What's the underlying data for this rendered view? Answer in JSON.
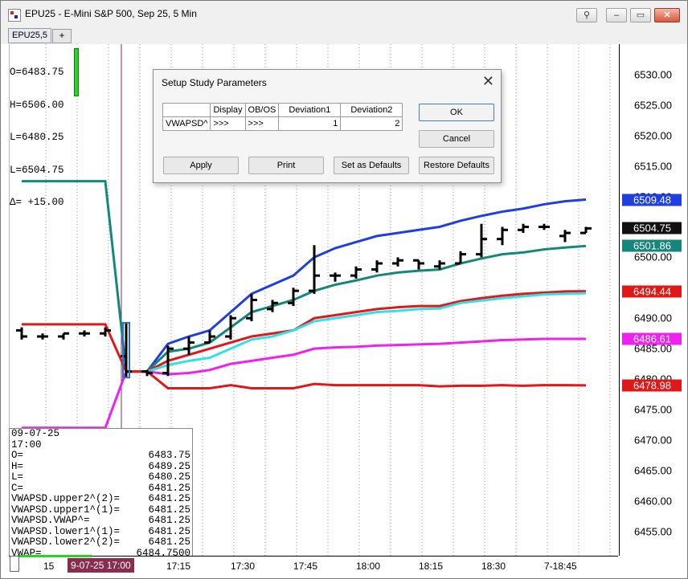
{
  "window": {
    "title": "EPU25 - E-Mini S&P 500, Sep 25, 5 Min",
    "close_glyph": "✕",
    "min_glyph": "–",
    "max_glyph": "▭",
    "link_glyph": "⚲"
  },
  "tabs": {
    "active_label": "EPU25,5",
    "add_label": "+"
  },
  "ohlc_overlay": [
    "O=6483.75",
    "H=6506.00",
    "L=6480.25",
    "L=6504.75",
    "Δ= +15.00"
  ],
  "data_window": {
    "date": "09-07-25",
    "time": "17:00",
    "rows": [
      {
        "k": "O=",
        "v": "6483.75"
      },
      {
        "k": "H=",
        "v": "6489.25"
      },
      {
        "k": "L=",
        "v": "6480.25"
      },
      {
        "k": "C=",
        "v": "6481.25"
      },
      {
        "k": "VWAPSD.upper2^(2)=",
        "v": "6481.25"
      },
      {
        "k": "VWAPSD.upper1^(1)=",
        "v": "6481.25"
      },
      {
        "k": "VWAPSD.VWAP^=",
        "v": "6481.25"
      },
      {
        "k": "VWAPSD.lower1^(1)=",
        "v": "6481.25"
      },
      {
        "k": "VWAPSD.lower2^(2)=",
        "v": "6481.25"
      },
      {
        "k": "VWAP=",
        "v": "6484.7500"
      }
    ]
  },
  "time_axis": {
    "cursor_label": "9-07-25  17:00",
    "labels": [
      {
        "text": "15",
        "x": 0
      },
      {
        "text": "17:15",
        "x": 0
      },
      {
        "text": "17:30",
        "x": 0
      },
      {
        "text": "17:45",
        "x": 0
      },
      {
        "text": "18:00",
        "x": 0
      },
      {
        "text": "18:15",
        "x": 0
      },
      {
        "text": "18:30",
        "x": 0
      },
      {
        "text": "7-18:45",
        "x": 0
      }
    ]
  },
  "price_axis": {
    "labels": [
      "6530.00",
      "6525.00",
      "6520.00",
      "6515.00",
      "6510.00",
      "6500.00",
      "6490.00",
      "6485.00",
      "6480.00",
      "6475.00",
      "6470.00",
      "6465.00",
      "6460.00",
      "6455.00"
    ],
    "badges": [
      {
        "text": "6509.48",
        "color": "#1f3fe0"
      },
      {
        "text": "6504.75",
        "color": "#111111"
      },
      {
        "text": "6501.86",
        "color": "#15877a"
      },
      {
        "text": "6494.44",
        "color": "#e01818"
      },
      {
        "text": "6486.61",
        "color": "#ee22ee"
      },
      {
        "text": "6478.98",
        "color": "#e01818"
      }
    ]
  },
  "chart_data": {
    "type": "line",
    "ylim": [
      6451,
      6535
    ],
    "x": [
      "16:35",
      "16:40",
      "16:45",
      "16:50",
      "16:55",
      "17:00",
      "17:05",
      "17:10",
      "17:15",
      "17:20",
      "17:25",
      "17:30",
      "17:35",
      "17:40",
      "17:45",
      "17:50",
      "17:55",
      "18:00",
      "18:05",
      "18:10",
      "18:15",
      "18:20",
      "18:25",
      "18:30",
      "18:35",
      "18:40",
      "18:45",
      "18:50"
    ],
    "ohlc": [
      [
        6488.0,
        6488.5,
        6486.5,
        6487.0
      ],
      [
        6487.0,
        6487.5,
        6486.5,
        6487.0
      ],
      [
        6487.0,
        6487.5,
        6486.5,
        6487.5
      ],
      [
        6487.5,
        6488.0,
        6487.0,
        6487.5
      ],
      [
        6487.5,
        6488.5,
        6487.0,
        6488.0
      ],
      [
        6483.75,
        6489.25,
        6480.25,
        6481.25
      ],
      [
        6481.25,
        6481.5,
        6480.5,
        6481.0
      ],
      [
        6481.0,
        6485.5,
        6480.5,
        6485.0
      ],
      [
        6485.0,
        6487.0,
        6484.0,
        6486.0
      ],
      [
        6486.0,
        6488.0,
        6486.0,
        6487.0
      ],
      [
        6487.0,
        6490.5,
        6486.5,
        6490.0
      ],
      [
        6490.0,
        6494.0,
        6489.5,
        6493.0
      ],
      [
        6491.5,
        6493.0,
        6491.0,
        6492.5
      ],
      [
        6492.5,
        6495.0,
        6492.0,
        6494.5
      ],
      [
        6494.5,
        6502.0,
        6494.0,
        6497.0
      ],
      [
        6497.0,
        6497.5,
        6496.0,
        6497.0
      ],
      [
        6497.0,
        6498.5,
        6496.5,
        6498.0
      ],
      [
        6498.0,
        6499.5,
        6497.5,
        6499.0
      ],
      [
        6499.0,
        6500.0,
        6498.5,
        6499.5
      ],
      [
        6499.5,
        6499.5,
        6498.0,
        6499.0
      ],
      [
        6498.5,
        6499.5,
        6498.0,
        6499.0
      ],
      [
        6499.0,
        6501.0,
        6499.0,
        6500.5
      ],
      [
        6500.5,
        6505.5,
        6500.0,
        6503.0
      ],
      [
        6503.0,
        6505.0,
        6502.0,
        6504.5
      ],
      [
        6504.5,
        6505.5,
        6504.0,
        6505.0
      ],
      [
        6505.0,
        6505.5,
        6504.5,
        6505.0
      ],
      [
        6503.5,
        6504.5,
        6502.5,
        6504.0
      ],
      [
        6504.0,
        6505.0,
        6504.0,
        6504.75
      ]
    ],
    "series": [
      {
        "color": "#1f3fe0",
        "values": [
          null,
          null,
          null,
          null,
          null,
          6481.25,
          6481.25,
          6485.8,
          6487.0,
          6488.0,
          6491.0,
          6494.0,
          6495.5,
          6497.0,
          6500.0,
          6501.5,
          6502.5,
          6503.5,
          6504.0,
          6504.5,
          6505.0,
          6506.0,
          6506.8,
          6507.5,
          6508.0,
          6508.7,
          6509.2,
          6509.48
        ]
      },
      {
        "color": "#15877a",
        "values": [
          6512.5,
          6512.5,
          6512.5,
          6512.5,
          6512.5,
          6481.25,
          6481.25,
          6484.5,
          6485.0,
          6486.0,
          6488.5,
          6491.0,
          6492.0,
          6493.0,
          6494.5,
          6495.5,
          6496.2,
          6497.0,
          6497.5,
          6497.8,
          6498.0,
          6499.0,
          6499.8,
          6500.5,
          6500.8,
          6501.3,
          6501.6,
          6501.86
        ]
      },
      {
        "color": "#e01818",
        "values": [
          6489.0,
          6489.0,
          6489.0,
          6489.0,
          6489.0,
          6481.25,
          6481.25,
          6483.0,
          6484.0,
          6485.0,
          6486.0,
          6487.0,
          6487.5,
          6488.0,
          6490.0,
          6490.5,
          6491.0,
          6491.5,
          6491.8,
          6492.0,
          6492.0,
          6492.8,
          6493.3,
          6493.7,
          6494.0,
          6494.2,
          6494.4,
          6494.44
        ]
      },
      {
        "color": "#33e0ea",
        "values": [
          null,
          null,
          null,
          null,
          null,
          6481.25,
          6481.25,
          6482.3,
          6483.0,
          6483.5,
          6485.0,
          6486.5,
          6487.0,
          6488.0,
          6489.5,
          6490.0,
          6490.5,
          6491.0,
          6491.2,
          6491.5,
          6491.6,
          6492.5,
          6492.9,
          6493.3,
          6493.6,
          6493.9,
          6494.0,
          6494.1
        ]
      },
      {
        "color": "#ee22ee",
        "values": [
          6472.0,
          6472.0,
          6472.0,
          6472.0,
          6472.0,
          6481.25,
          6481.25,
          6480.8,
          6481.0,
          6481.5,
          6482.5,
          6483.0,
          6483.5,
          6484.0,
          6485.0,
          6485.2,
          6485.3,
          6485.5,
          6485.6,
          6485.7,
          6485.8,
          6486.0,
          6486.2,
          6486.4,
          6486.5,
          6486.6,
          6486.6,
          6486.61
        ]
      },
      {
        "color": "#e01818",
        "values": [
          null,
          null,
          null,
          null,
          null,
          6481.25,
          6481.25,
          6478.5,
          6478.5,
          6478.5,
          6479.0,
          6478.5,
          6478.5,
          6478.5,
          6479.2,
          6479.0,
          6479.0,
          6479.0,
          6479.0,
          6479.0,
          6478.8,
          6478.9,
          6478.9,
          6479.0,
          6478.9,
          6479.0,
          6479.0,
          6478.98
        ]
      }
    ]
  },
  "dialog": {
    "title": "Setup Study Parameters",
    "close_glyph": "✕",
    "headers": [
      "",
      "Display",
      "OB/OS",
      "Deviation1",
      "Deviation2"
    ],
    "row": [
      "VWAPSD^",
      ">>>",
      ">>>",
      "1",
      "2"
    ],
    "ok_label": "OK",
    "cancel_label": "Cancel",
    "apply_label": "Apply",
    "print_label": "Print",
    "set_defaults_label": "Set as Defaults",
    "restore_defaults_label": "Restore Defaults"
  }
}
